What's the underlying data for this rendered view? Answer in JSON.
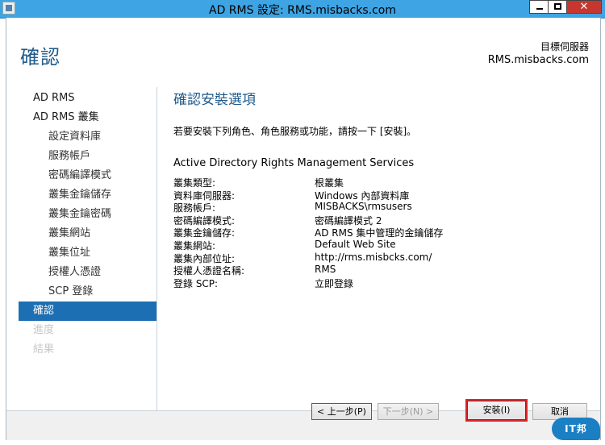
{
  "window": {
    "title": "AD RMS 設定: RMS.misbacks.com",
    "controls": [
      "minimize",
      "maximize",
      "close"
    ],
    "close_glyph": "✕"
  },
  "header": {
    "page_title": "確認",
    "destination_label": "目標伺服器",
    "destination_server": "RMS.misbacks.com"
  },
  "nav": {
    "items": [
      {
        "label": "AD RMS",
        "level": 0,
        "state": "normal"
      },
      {
        "label": "AD RMS 叢集",
        "level": 0,
        "state": "normal"
      },
      {
        "label": "設定資料庫",
        "level": 1,
        "state": "normal"
      },
      {
        "label": "服務帳戶",
        "level": 1,
        "state": "normal"
      },
      {
        "label": "密碼編譯模式",
        "level": 1,
        "state": "normal"
      },
      {
        "label": "叢集金鑰儲存",
        "level": 1,
        "state": "normal"
      },
      {
        "label": "叢集金鑰密碼",
        "level": 1,
        "state": "normal"
      },
      {
        "label": "叢集網站",
        "level": 1,
        "state": "normal"
      },
      {
        "label": "叢集位址",
        "level": 1,
        "state": "normal"
      },
      {
        "label": "授權人憑證",
        "level": 1,
        "state": "normal"
      },
      {
        "label": "SCP 登錄",
        "level": 1,
        "state": "normal"
      },
      {
        "label": "確認",
        "level": 0,
        "state": "active"
      },
      {
        "label": "進度",
        "level": 0,
        "state": "disabled"
      },
      {
        "label": "結果",
        "level": 0,
        "state": "disabled"
      }
    ]
  },
  "content": {
    "section_title": "確認安裝選項",
    "intro": "若要安裝下列角色、角色服務或功能，請按一下 [安裝]。",
    "role_title": "Active Directory Rights Management Services",
    "properties": [
      {
        "key": "叢集類型:",
        "value": "根叢集"
      },
      {
        "key": "資料庫伺服器:",
        "value": "Windows 內部資料庫"
      },
      {
        "key": "服務帳戶:",
        "value": "MISBACKS\\rmsusers"
      },
      {
        "key": "密碼編譯模式:",
        "value": "密碼編譯模式 2"
      },
      {
        "key": "叢集金鑰儲存:",
        "value": "AD RMS 集中管理的金鑰儲存"
      },
      {
        "key": "叢集網站:",
        "value": "Default Web Site"
      },
      {
        "key": "叢集內部位址:",
        "value": "http://rms.misbcks.com/"
      },
      {
        "key": "授權人憑證名稱:",
        "value": "RMS"
      },
      {
        "key": "登錄 SCP:",
        "value": "立即登錄"
      }
    ]
  },
  "buttons": {
    "prev": "< 上一步(P)",
    "next": "下一步(N) >",
    "install": "安裝(I)",
    "cancel": "取消"
  },
  "watermark": {
    "text": "IT邦"
  },
  "colors": {
    "titlebar": "#3ea4e3",
    "accent": "#1d6fb3",
    "close": "#c7372f",
    "highlight": "#d6262b"
  }
}
